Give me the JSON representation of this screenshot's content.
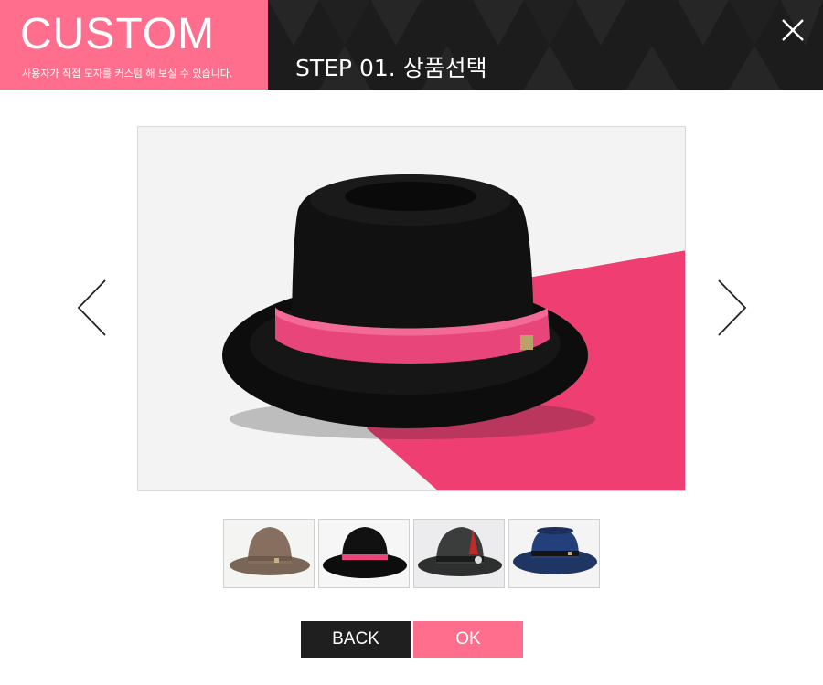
{
  "header": {
    "brand_title": "CUSTOM",
    "brand_subtitle": "사용자가 직접 모자를 커스텀 해 보실 수 있습니다.",
    "step_title": "STEP 01. 상품선택",
    "close_icon": "close-icon"
  },
  "colors": {
    "brand_pink": "#ff6e8c",
    "header_dark": "#1c1c1c",
    "button_dark": "#1f1f1f"
  },
  "viewer": {
    "prev_icon": "chevron-left-icon",
    "next_icon": "chevron-right-icon",
    "selected_index": 1
  },
  "thumbnails": [
    {
      "name": "brown-fedora"
    },
    {
      "name": "black-porkpie-pink-band"
    },
    {
      "name": "charcoal-fedora-feather"
    },
    {
      "name": "navy-porkpie"
    }
  ],
  "buttons": {
    "back_label": "BACK",
    "ok_label": "OK"
  }
}
